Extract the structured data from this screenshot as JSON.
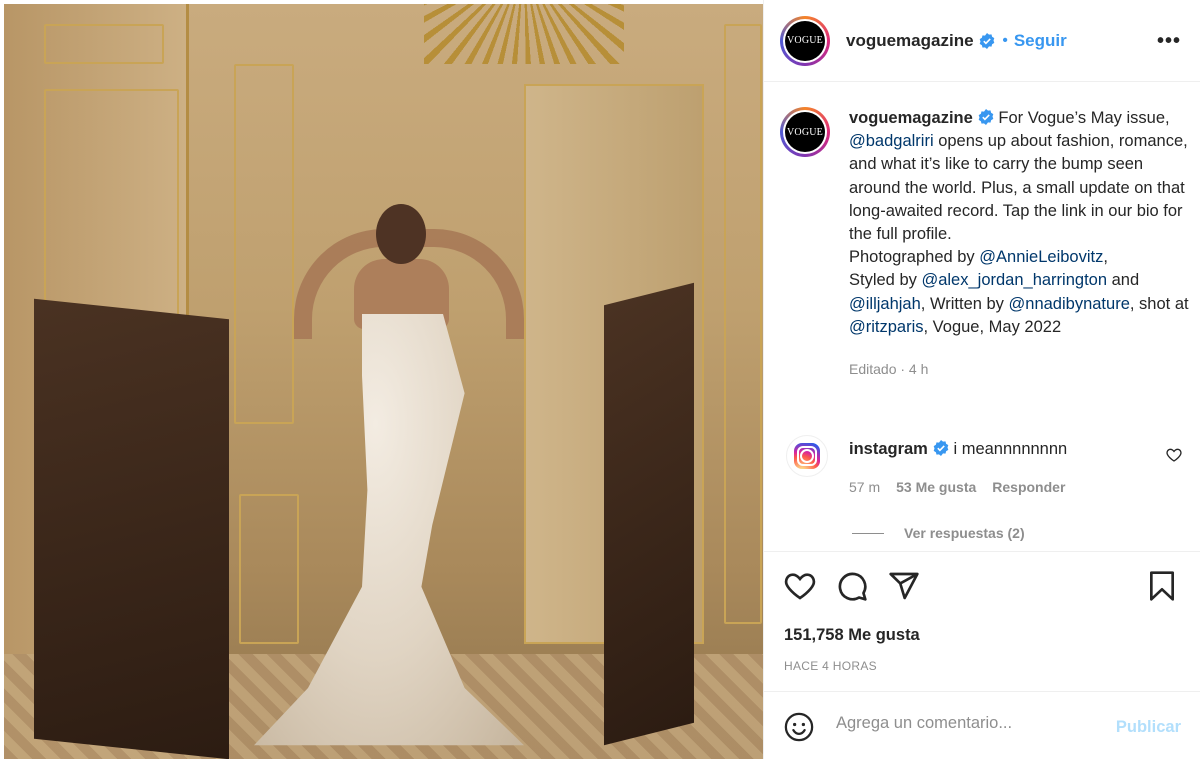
{
  "post": {
    "account": "voguemagazine",
    "avatar_text": "VOGUE",
    "follow_label": "Seguir",
    "separator": "•",
    "more_label": "•••"
  },
  "caption": {
    "username": "voguemagazine",
    "parts": [
      {
        "t": "text",
        "v": " For Vogue’s May issue, "
      },
      {
        "t": "mention",
        "v": "@badgalriri"
      },
      {
        "t": "text",
        "v": " opens up about fashion, romance, and what it’s like to carry the bump seen around the world. Plus, a small update on that long-awaited record. Tap the link in our bio for the full profile."
      },
      {
        "t": "br"
      },
      {
        "t": "text",
        "v": "Photographed by "
      },
      {
        "t": "mention",
        "v": "@AnnieLeibovitz"
      },
      {
        "t": "text",
        "v": ","
      },
      {
        "t": "br"
      },
      {
        "t": "text",
        "v": "Styled by "
      },
      {
        "t": "mention",
        "v": "@alex_jordan_harrington"
      },
      {
        "t": "text",
        "v": " and "
      },
      {
        "t": "mention",
        "v": "@illjahjah"
      },
      {
        "t": "text",
        "v": ", Written by "
      },
      {
        "t": "mention",
        "v": "@nnadibynature"
      },
      {
        "t": "text",
        "v": ", shot at "
      },
      {
        "t": "mention",
        "v": "@ritzparis"
      },
      {
        "t": "text",
        "v": ", Vogue, May 2022"
      }
    ],
    "edited": "Editado · 4 h"
  },
  "comment": {
    "username": "instagram",
    "text": " i meannnnnnnn",
    "time": "57 m",
    "likes": "53 Me gusta",
    "reply_label": "Responder",
    "view_replies": "Ver respuestas (2)"
  },
  "stats": {
    "likes": "151,758 Me gusta",
    "time": "HACE 4 HORAS"
  },
  "composer": {
    "placeholder": "Agrega un comentario...",
    "publish_label": "Publicar"
  },
  "icons": {
    "verified": "verified-badge-icon",
    "like": "heart-icon",
    "comment": "comment-bubble-icon",
    "share": "paper-plane-icon",
    "save": "bookmark-icon",
    "emoji": "emoji-icon",
    "instagram": "instagram-logo-icon"
  },
  "colors": {
    "accent": "#3897f0",
    "mention": "#00376b",
    "muted": "#8e8e8e",
    "publish_disabled": "#b2dffc"
  }
}
